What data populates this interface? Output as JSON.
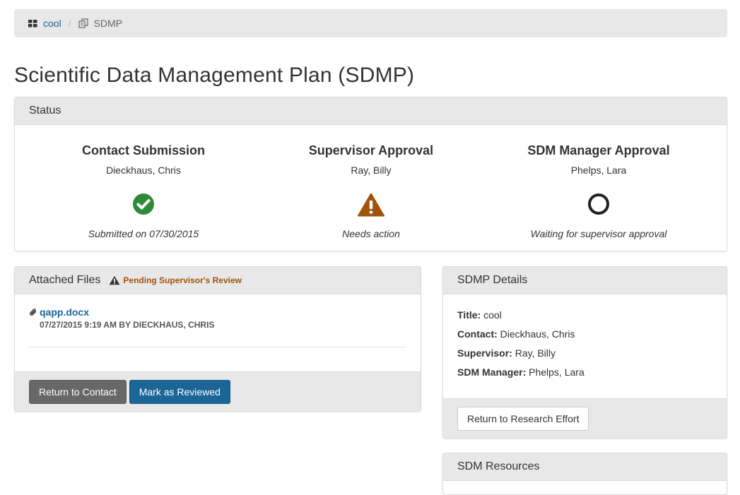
{
  "breadcrumb": {
    "home_label": "cool",
    "current_label": "SDMP"
  },
  "page": {
    "title": "Scientific Data Management Plan (SDMP)"
  },
  "status": {
    "heading": "Status",
    "steps": [
      {
        "title": "Contact Submission",
        "person": "Dieckhaus, Chris",
        "icon": "check-circle-icon",
        "note": "Submitted on 07/30/2015"
      },
      {
        "title": "Supervisor Approval",
        "person": "Ray, Billy",
        "icon": "warning-icon",
        "note": "Needs action"
      },
      {
        "title": "SDM Manager Approval",
        "person": "Phelps, Lara",
        "icon": "circle-outline-icon",
        "note": "Waiting for supervisor approval"
      }
    ]
  },
  "files": {
    "heading": "Attached Files",
    "badge": "Pending Supervisor's Review",
    "items": [
      {
        "name": "qapp.docx",
        "meta": "07/27/2015 9:19 AM by Dieckhaus, Chris"
      }
    ],
    "return_button": "Return to Contact",
    "review_button": "Mark as Reviewed"
  },
  "details": {
    "heading": "SDMP Details",
    "title_label": "Title:",
    "title_value": "cool",
    "contact_label": "Contact:",
    "contact_value": "Dieckhaus, Chris",
    "supervisor_label": "Supervisor:",
    "supervisor_value": "Ray, Billy",
    "manager_label": "SDM Manager:",
    "manager_value": "Phelps, Lara",
    "return_button": "Return to Research Effort"
  },
  "resources": {
    "heading": "SDM Resources"
  },
  "colors": {
    "success": "#2e8b3a",
    "warning": "#a0520b",
    "link": "#1b6597",
    "panel_header": "#e8e8e8"
  }
}
